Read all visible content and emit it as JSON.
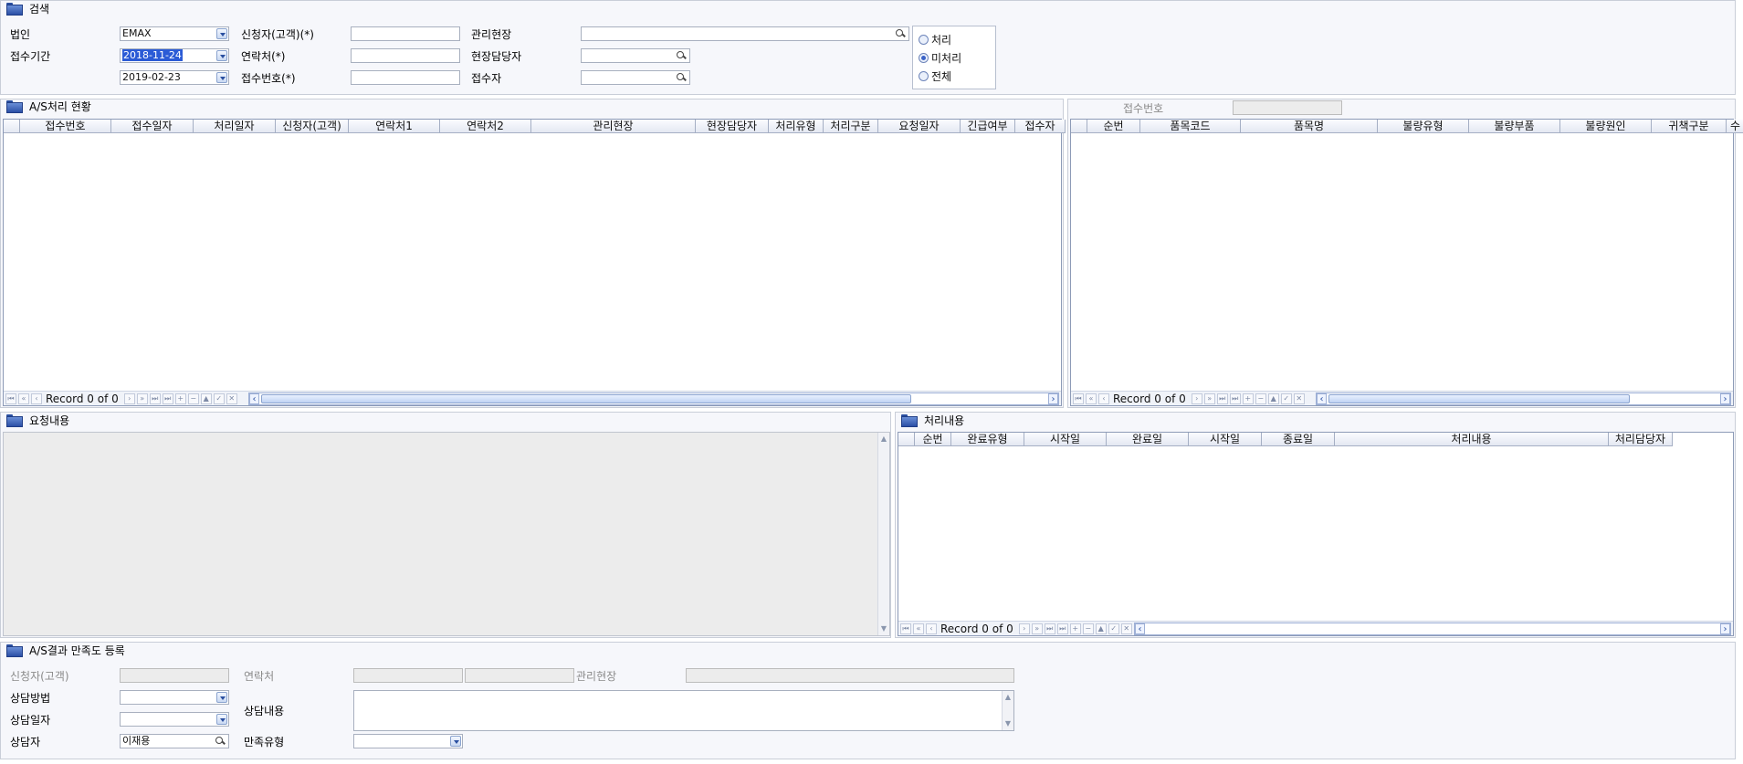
{
  "search": {
    "title": "검색",
    "corp_label": "법인",
    "corp_value": "EMAX",
    "period_label": "접수기간",
    "date_from": "2018-11-24",
    "date_to": "2019-02-23",
    "applicant_label": "신청자(고객)(*)",
    "contact_label": "연락처(*)",
    "receipt_no_label": "접수번호(*)",
    "site_label": "관리현장",
    "site_manager_label": "현장담당자",
    "receiver_label": "접수자",
    "radio_processed": "처리",
    "radio_unprocessed": "미처리",
    "radio_all": "전체"
  },
  "as_status": {
    "title": "A/S처리 현황",
    "columns": [
      "접수번호",
      "접수일자",
      "처리일자",
      "신청자(고객)",
      "연락처1",
      "연락처2",
      "관리현장",
      "현장담당자",
      "처리유형",
      "처리구분",
      "요청일자",
      "긴급여부",
      "접수자"
    ],
    "record_text": "Record 0 of 0"
  },
  "items": {
    "receipt_no_label": "접수번호",
    "columns": [
      "순번",
      "품목코드",
      "품목명",
      "불량유형",
      "불량부품",
      "불량원인",
      "귀책구분",
      "수"
    ],
    "record_text": "Record 0 of 0"
  },
  "request": {
    "title": "요청내용"
  },
  "process": {
    "title": "처리내용",
    "columns": [
      "순번",
      "완료유형",
      "시작일",
      "완료일",
      "시작일",
      "종료일",
      "처리내용",
      "처리담당자"
    ],
    "record_text": "Record 0 of 0"
  },
  "satisfaction": {
    "title": "A/S결과 만족도 등록",
    "applicant_label": "신청자(고객)",
    "contact_label": "연락처",
    "site_label": "관리현장",
    "method_label": "상담방법",
    "date_label": "상담일자",
    "content_label": "상담내용",
    "counselor_label": "상담자",
    "counselor_value": "이재용",
    "type_label": "만족유형"
  },
  "nav_glyphs": [
    "⏮",
    "«",
    "‹",
    "›",
    "»",
    "⏭",
    "+",
    "−",
    "▲",
    "✓",
    "✕"
  ]
}
